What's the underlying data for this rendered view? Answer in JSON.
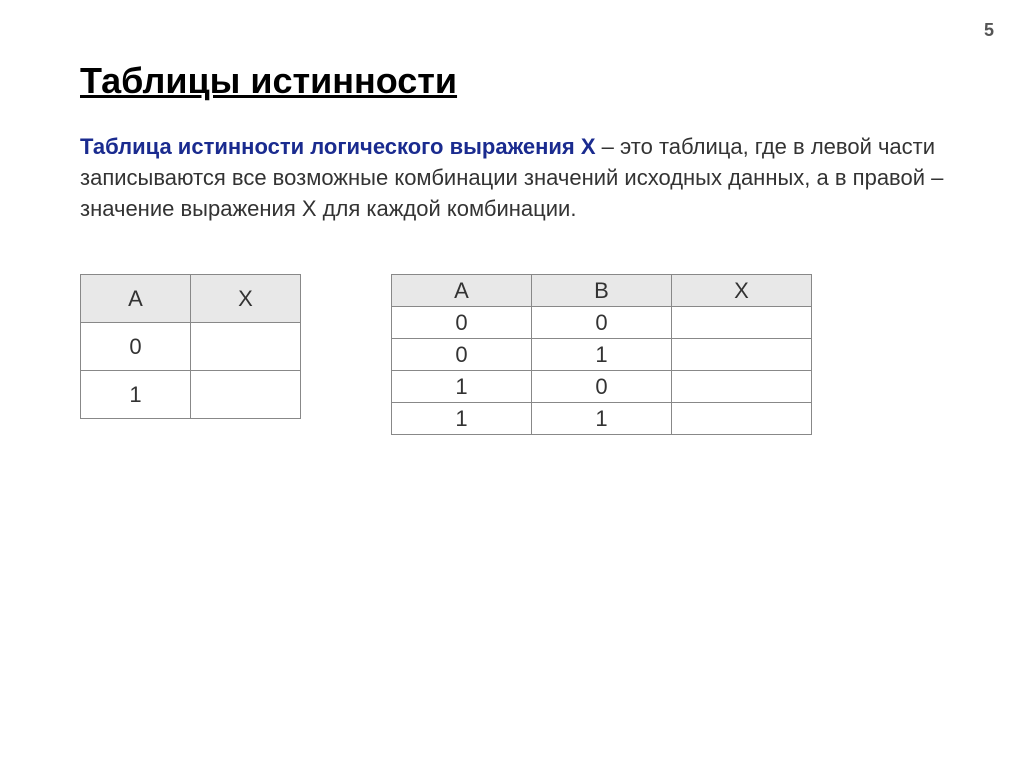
{
  "page_number": "5",
  "title": "Таблицы истинности",
  "description_highlight": "Таблица истинности логического выражения X",
  "description_rest": " – это таблица, где в левой части записываются все возможные комбинации значений исходных данных, а в правой – значение выражения X для каждой комбинации.",
  "table1": {
    "headers": [
      "A",
      "X"
    ],
    "rows": [
      [
        "0",
        ""
      ],
      [
        "1",
        ""
      ]
    ]
  },
  "table2": {
    "headers": [
      "A",
      "B",
      "X"
    ],
    "rows": [
      [
        "0",
        "0",
        ""
      ],
      [
        "0",
        "1",
        ""
      ],
      [
        "1",
        "0",
        ""
      ],
      [
        "1",
        "1",
        ""
      ]
    ]
  }
}
